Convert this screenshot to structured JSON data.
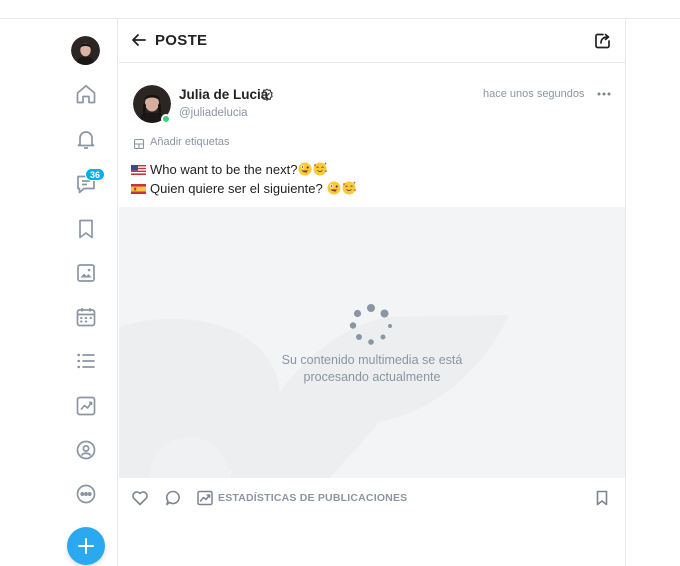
{
  "header": {
    "title": "POSTE"
  },
  "sidebar": {
    "messages_badge": "36"
  },
  "post": {
    "author_name": "Julia de Lucia",
    "author_handle": "@juliadelucia",
    "timestamp": "hace unos segundos",
    "add_tags_label": "Añadir etiquetas",
    "line1": "Who want to be the next?",
    "line2": "Quien quiere ser el siguiente? ",
    "media_message_line1": "Su contenido multimedia se está",
    "media_message_line2": "procesando actualmente"
  },
  "actions": {
    "stats_label": "ESTADÍSTICAS DE PUBLICACIONES"
  },
  "colors": {
    "accent": "#00aff0",
    "fab": "#2aa8f0",
    "muted_text": "#8a96a3",
    "online": "#3cd27a"
  },
  "icons": [
    "home-icon",
    "bell-icon",
    "messages-icon",
    "bookmark-icon",
    "collections-icon",
    "calendar-icon",
    "lists-icon",
    "statistics-icon",
    "profile-icon",
    "more-icon",
    "plus-icon",
    "back-arrow-icon",
    "share-icon",
    "verified-icon",
    "ellipsis-icon",
    "tag-icon",
    "like-icon",
    "comment-icon",
    "stats-icon"
  ]
}
